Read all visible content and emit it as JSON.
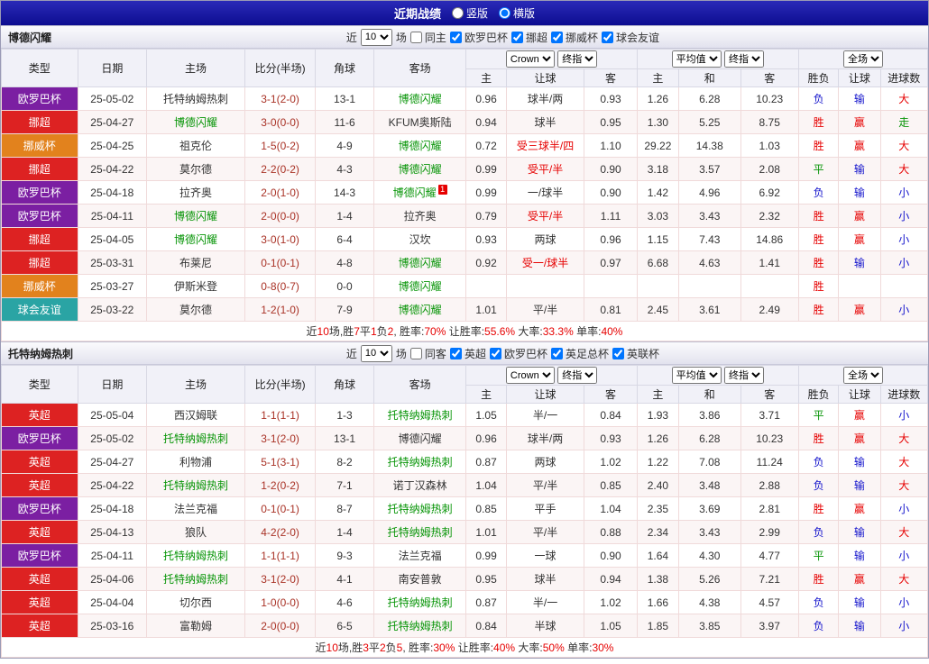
{
  "topbar": {
    "title": "近期战绩",
    "radios": {
      "vertical": "竖版",
      "horizontal": "横版",
      "selected": "横版"
    }
  },
  "table_head": {
    "type": "类型",
    "date": "日期",
    "home": "主场",
    "score": "比分(半场)",
    "corner": "角球",
    "away": "客场",
    "odds_home": "主",
    "odds_handicap": "让球",
    "odds_away": "客",
    "avg_home": "主",
    "avg_draw": "和",
    "avg_away": "客",
    "result": "胜负",
    "handicap_result": "让球",
    "goals": "进球数"
  },
  "palette": {
    "win_red": "#e60000",
    "lose_blue": "#1414cc",
    "draw_green": "#089508",
    "team_green": "#089508",
    "europa_purple": "#7b1fa2",
    "league_red": "#dd2222",
    "cup_orange": "#e2821d",
    "friendly_teal": "#2aa4a4"
  },
  "sections": [
    {
      "team": "博德闪耀",
      "filters": {
        "near": "近",
        "games": "10",
        "games_suffix": "场",
        "same": "同主",
        "same_checked": false,
        "leagues": [
          {
            "label": "欧罗巴杯",
            "checked": true
          },
          {
            "label": "挪超",
            "checked": true
          },
          {
            "label": "挪威杯",
            "checked": true
          },
          {
            "label": "球会友谊",
            "checked": true
          }
        ]
      },
      "selects": {
        "odds_source": "Crown",
        "odds_stage": "终指",
        "avg_source": "平均值",
        "avg_stage": "终指",
        "scope": "全场"
      },
      "rows": [
        {
          "lg": "欧罗巴杯",
          "lc": "#7b1fa2",
          "dt": "25-05-02",
          "hm": "托特纳姆热刺",
          "hmc": "#333333",
          "sc": "3-1(2-0)",
          "cn": "13-1",
          "aw": "博德闪耀",
          "awc": "#089508",
          "card": "",
          "o1": "0.96",
          "hd": "球半/两",
          "hdc": "#333333",
          "o2": "0.93",
          "m1": "1.26",
          "m2": "6.28",
          "m3": "10.23",
          "r1": "负",
          "r1c": "#1414cc",
          "r2": "输",
          "r2c": "#1414cc",
          "r3": "大",
          "r3c": "#e60000"
        },
        {
          "lg": "挪超",
          "lc": "#dd2222",
          "dt": "25-04-27",
          "hm": "博德闪耀",
          "hmc": "#089508",
          "sc": "3-0(0-0)",
          "cn": "11-6",
          "aw": "KFUM奥斯陆",
          "awc": "#333333",
          "card": "",
          "o1": "0.94",
          "hd": "球半",
          "hdc": "#333333",
          "o2": "0.95",
          "m1": "1.30",
          "m2": "5.25",
          "m3": "8.75",
          "r1": "胜",
          "r1c": "#e60000",
          "r2": "赢",
          "r2c": "#e60000",
          "r3": "走",
          "r3c": "#089508"
        },
        {
          "lg": "挪威杯",
          "lc": "#e2821d",
          "dt": "25-04-25",
          "hm": "祖克伦",
          "hmc": "#333333",
          "sc": "1-5(0-2)",
          "cn": "4-9",
          "aw": "博德闪耀",
          "awc": "#089508",
          "card": "",
          "o1": "0.72",
          "hd": "受三球半/四",
          "hdc": "#e60000",
          "o2": "1.10",
          "m1": "29.22",
          "m2": "14.38",
          "m3": "1.03",
          "r1": "胜",
          "r1c": "#e60000",
          "r2": "赢",
          "r2c": "#e60000",
          "r3": "大",
          "r3c": "#e60000"
        },
        {
          "lg": "挪超",
          "lc": "#dd2222",
          "dt": "25-04-22",
          "hm": "莫尔德",
          "hmc": "#333333",
          "sc": "2-2(0-2)",
          "cn": "4-3",
          "aw": "博德闪耀",
          "awc": "#089508",
          "card": "",
          "o1": "0.99",
          "hd": "受平/半",
          "hdc": "#e60000",
          "o2": "0.90",
          "m1": "3.18",
          "m2": "3.57",
          "m3": "2.08",
          "r1": "平",
          "r1c": "#089508",
          "r2": "输",
          "r2c": "#1414cc",
          "r3": "大",
          "r3c": "#e60000"
        },
        {
          "lg": "欧罗巴杯",
          "lc": "#7b1fa2",
          "dt": "25-04-18",
          "hm": "拉齐奥",
          "hmc": "#333333",
          "sc": "2-0(1-0)",
          "cn": "14-3",
          "aw": "博德闪耀",
          "awc": "#089508",
          "card": "1",
          "o1": "0.99",
          "hd": "一/球半",
          "hdc": "#333333",
          "o2": "0.90",
          "m1": "1.42",
          "m2": "4.96",
          "m3": "6.92",
          "r1": "负",
          "r1c": "#1414cc",
          "r2": "输",
          "r2c": "#1414cc",
          "r3": "小",
          "r3c": "#1414cc"
        },
        {
          "lg": "欧罗巴杯",
          "lc": "#7b1fa2",
          "dt": "25-04-11",
          "hm": "博德闪耀",
          "hmc": "#089508",
          "sc": "2-0(0-0)",
          "cn": "1-4",
          "aw": "拉齐奥",
          "awc": "#333333",
          "card": "",
          "o1": "0.79",
          "hd": "受平/半",
          "hdc": "#e60000",
          "o2": "1.11",
          "m1": "3.03",
          "m2": "3.43",
          "m3": "2.32",
          "r1": "胜",
          "r1c": "#e60000",
          "r2": "赢",
          "r2c": "#e60000",
          "r3": "小",
          "r3c": "#1414cc"
        },
        {
          "lg": "挪超",
          "lc": "#dd2222",
          "dt": "25-04-05",
          "hm": "博德闪耀",
          "hmc": "#089508",
          "sc": "3-0(1-0)",
          "cn": "6-4",
          "aw": "汉坎",
          "awc": "#333333",
          "card": "",
          "o1": "0.93",
          "hd": "两球",
          "hdc": "#333333",
          "o2": "0.96",
          "m1": "1.15",
          "m2": "7.43",
          "m3": "14.86",
          "r1": "胜",
          "r1c": "#e60000",
          "r2": "赢",
          "r2c": "#e60000",
          "r3": "小",
          "r3c": "#1414cc"
        },
        {
          "lg": "挪超",
          "lc": "#dd2222",
          "dt": "25-03-31",
          "hm": "布莱尼",
          "hmc": "#333333",
          "sc": "0-1(0-1)",
          "cn": "4-8",
          "aw": "博德闪耀",
          "awc": "#089508",
          "card": "",
          "o1": "0.92",
          "hd": "受一/球半",
          "hdc": "#e60000",
          "o2": "0.97",
          "m1": "6.68",
          "m2": "4.63",
          "m3": "1.41",
          "r1": "胜",
          "r1c": "#e60000",
          "r2": "输",
          "r2c": "#1414cc",
          "r3": "小",
          "r3c": "#1414cc"
        },
        {
          "lg": "挪威杯",
          "lc": "#e2821d",
          "dt": "25-03-27",
          "hm": "伊斯米登",
          "hmc": "#333333",
          "sc": "0-8(0-7)",
          "cn": "0-0",
          "aw": "博德闪耀",
          "awc": "#089508",
          "card": "",
          "o1": "",
          "hd": "",
          "hdc": "#333333",
          "o2": "",
          "m1": "",
          "m2": "",
          "m3": "",
          "r1": "胜",
          "r1c": "#e60000",
          "r2": "",
          "r2c": "#333333",
          "r3": "",
          "r3c": "#333333"
        },
        {
          "lg": "球会友谊",
          "lc": "#2aa4a4",
          "dt": "25-03-22",
          "hm": "莫尔德",
          "hmc": "#333333",
          "sc": "1-2(1-0)",
          "cn": "7-9",
          "aw": "博德闪耀",
          "awc": "#089508",
          "card": "",
          "o1": "1.01",
          "hd": "平/半",
          "hdc": "#333333",
          "o2": "0.81",
          "m1": "2.45",
          "m2": "3.61",
          "m3": "2.49",
          "r1": "胜",
          "r1c": "#e60000",
          "r2": "赢",
          "r2c": "#e60000",
          "r3": "小",
          "r3c": "#1414cc"
        }
      ],
      "summary": [
        {
          "t": "近",
          "c": "#333333"
        },
        {
          "t": "10",
          "c": "#e60000"
        },
        {
          "t": "场,胜",
          "c": "#333333"
        },
        {
          "t": "7",
          "c": "#e60000"
        },
        {
          "t": "平",
          "c": "#333333"
        },
        {
          "t": "1",
          "c": "#e60000"
        },
        {
          "t": "负",
          "c": "#333333"
        },
        {
          "t": "2",
          "c": "#e60000"
        },
        {
          "t": ", 胜率:",
          "c": "#333333"
        },
        {
          "t": "70%",
          "c": "#e60000"
        },
        {
          "t": " 让胜率:",
          "c": "#333333"
        },
        {
          "t": "55.6%",
          "c": "#e60000"
        },
        {
          "t": " 大率:",
          "c": "#333333"
        },
        {
          "t": "33.3%",
          "c": "#e60000"
        },
        {
          "t": " 单率:",
          "c": "#333333"
        },
        {
          "t": "40%",
          "c": "#e60000"
        }
      ]
    },
    {
      "team": "托特纳姆热刺",
      "filters": {
        "near": "近",
        "games": "10",
        "games_suffix": "场",
        "same": "同客",
        "same_checked": false,
        "leagues": [
          {
            "label": "英超",
            "checked": true
          },
          {
            "label": "欧罗巴杯",
            "checked": true
          },
          {
            "label": "英足总杯",
            "checked": true
          },
          {
            "label": "英联杯",
            "checked": true
          }
        ]
      },
      "selects": {
        "odds_source": "Crown",
        "odds_stage": "终指",
        "avg_source": "平均值",
        "avg_stage": "终指",
        "scope": "全场"
      },
      "rows": [
        {
          "lg": "英超",
          "lc": "#dd2222",
          "dt": "25-05-04",
          "hm": "西汉姆联",
          "hmc": "#333333",
          "sc": "1-1(1-1)",
          "cn": "1-3",
          "aw": "托特纳姆热刺",
          "awc": "#089508",
          "card": "",
          "o1": "1.05",
          "hd": "半/一",
          "hdc": "#333333",
          "o2": "0.84",
          "m1": "1.93",
          "m2": "3.86",
          "m3": "3.71",
          "r1": "平",
          "r1c": "#089508",
          "r2": "赢",
          "r2c": "#e60000",
          "r3": "小",
          "r3c": "#1414cc"
        },
        {
          "lg": "欧罗巴杯",
          "lc": "#7b1fa2",
          "dt": "25-05-02",
          "hm": "托特纳姆热刺",
          "hmc": "#089508",
          "sc": "3-1(2-0)",
          "cn": "13-1",
          "aw": "博德闪耀",
          "awc": "#333333",
          "card": "",
          "o1": "0.96",
          "hd": "球半/两",
          "hdc": "#333333",
          "o2": "0.93",
          "m1": "1.26",
          "m2": "6.28",
          "m3": "10.23",
          "r1": "胜",
          "r1c": "#e60000",
          "r2": "赢",
          "r2c": "#e60000",
          "r3": "大",
          "r3c": "#e60000"
        },
        {
          "lg": "英超",
          "lc": "#dd2222",
          "dt": "25-04-27",
          "hm": "利物浦",
          "hmc": "#333333",
          "sc": "5-1(3-1)",
          "cn": "8-2",
          "aw": "托特纳姆热刺",
          "awc": "#089508",
          "card": "",
          "o1": "0.87",
          "hd": "两球",
          "hdc": "#333333",
          "o2": "1.02",
          "m1": "1.22",
          "m2": "7.08",
          "m3": "11.24",
          "r1": "负",
          "r1c": "#1414cc",
          "r2": "输",
          "r2c": "#1414cc",
          "r3": "大",
          "r3c": "#e60000"
        },
        {
          "lg": "英超",
          "lc": "#dd2222",
          "dt": "25-04-22",
          "hm": "托特纳姆热刺",
          "hmc": "#089508",
          "sc": "1-2(0-2)",
          "cn": "7-1",
          "aw": "诺丁汉森林",
          "awc": "#333333",
          "card": "",
          "o1": "1.04",
          "hd": "平/半",
          "hdc": "#333333",
          "o2": "0.85",
          "m1": "2.40",
          "m2": "3.48",
          "m3": "2.88",
          "r1": "负",
          "r1c": "#1414cc",
          "r2": "输",
          "r2c": "#1414cc",
          "r3": "大",
          "r3c": "#e60000"
        },
        {
          "lg": "欧罗巴杯",
          "lc": "#7b1fa2",
          "dt": "25-04-18",
          "hm": "法兰克福",
          "hmc": "#333333",
          "sc": "0-1(0-1)",
          "cn": "8-7",
          "aw": "托特纳姆热刺",
          "awc": "#089508",
          "card": "",
          "o1": "0.85",
          "hd": "平手",
          "hdc": "#333333",
          "o2": "1.04",
          "m1": "2.35",
          "m2": "3.69",
          "m3": "2.81",
          "r1": "胜",
          "r1c": "#e60000",
          "r2": "赢",
          "r2c": "#e60000",
          "r3": "小",
          "r3c": "#1414cc"
        },
        {
          "lg": "英超",
          "lc": "#dd2222",
          "dt": "25-04-13",
          "hm": "狼队",
          "hmc": "#333333",
          "sc": "4-2(2-0)",
          "cn": "1-4",
          "aw": "托特纳姆热刺",
          "awc": "#089508",
          "card": "",
          "o1": "1.01",
          "hd": "平/半",
          "hdc": "#333333",
          "o2": "0.88",
          "m1": "2.34",
          "m2": "3.43",
          "m3": "2.99",
          "r1": "负",
          "r1c": "#1414cc",
          "r2": "输",
          "r2c": "#1414cc",
          "r3": "大",
          "r3c": "#e60000"
        },
        {
          "lg": "欧罗巴杯",
          "lc": "#7b1fa2",
          "dt": "25-04-11",
          "hm": "托特纳姆热刺",
          "hmc": "#089508",
          "sc": "1-1(1-1)",
          "cn": "9-3",
          "aw": "法兰克福",
          "awc": "#333333",
          "card": "",
          "o1": "0.99",
          "hd": "一球",
          "hdc": "#333333",
          "o2": "0.90",
          "m1": "1.64",
          "m2": "4.30",
          "m3": "4.77",
          "r1": "平",
          "r1c": "#089508",
          "r2": "输",
          "r2c": "#1414cc",
          "r3": "小",
          "r3c": "#1414cc"
        },
        {
          "lg": "英超",
          "lc": "#dd2222",
          "dt": "25-04-06",
          "hm": "托特纳姆热刺",
          "hmc": "#089508",
          "sc": "3-1(2-0)",
          "cn": "4-1",
          "aw": "南安普敦",
          "awc": "#333333",
          "card": "",
          "o1": "0.95",
          "hd": "球半",
          "hdc": "#333333",
          "o2": "0.94",
          "m1": "1.38",
          "m2": "5.26",
          "m3": "7.21",
          "r1": "胜",
          "r1c": "#e60000",
          "r2": "赢",
          "r2c": "#e60000",
          "r3": "大",
          "r3c": "#e60000"
        },
        {
          "lg": "英超",
          "lc": "#dd2222",
          "dt": "25-04-04",
          "hm": "切尔西",
          "hmc": "#333333",
          "sc": "1-0(0-0)",
          "cn": "4-6",
          "aw": "托特纳姆热刺",
          "awc": "#089508",
          "card": "",
          "o1": "0.87",
          "hd": "半/一",
          "hdc": "#333333",
          "o2": "1.02",
          "m1": "1.66",
          "m2": "4.38",
          "m3": "4.57",
          "r1": "负",
          "r1c": "#1414cc",
          "r2": "输",
          "r2c": "#1414cc",
          "r3": "小",
          "r3c": "#1414cc"
        },
        {
          "lg": "英超",
          "lc": "#dd2222",
          "dt": "25-03-16",
          "hm": "富勒姆",
          "hmc": "#333333",
          "sc": "2-0(0-0)",
          "cn": "6-5",
          "aw": "托特纳姆热刺",
          "awc": "#089508",
          "card": "",
          "o1": "0.84",
          "hd": "半球",
          "hdc": "#333333",
          "o2": "1.05",
          "m1": "1.85",
          "m2": "3.85",
          "m3": "3.97",
          "r1": "负",
          "r1c": "#1414cc",
          "r2": "输",
          "r2c": "#1414cc",
          "r3": "小",
          "r3c": "#1414cc"
        }
      ],
      "summary": [
        {
          "t": "近",
          "c": "#333333"
        },
        {
          "t": "10",
          "c": "#e60000"
        },
        {
          "t": "场,胜",
          "c": "#333333"
        },
        {
          "t": "3",
          "c": "#e60000"
        },
        {
          "t": "平",
          "c": "#333333"
        },
        {
          "t": "2",
          "c": "#e60000"
        },
        {
          "t": "负",
          "c": "#333333"
        },
        {
          "t": "5",
          "c": "#e60000"
        },
        {
          "t": ", 胜率:",
          "c": "#333333"
        },
        {
          "t": "30%",
          "c": "#e60000"
        },
        {
          "t": " 让胜率:",
          "c": "#333333"
        },
        {
          "t": "40%",
          "c": "#e60000"
        },
        {
          "t": " 大率:",
          "c": "#333333"
        },
        {
          "t": "50%",
          "c": "#e60000"
        },
        {
          "t": " 单率:",
          "c": "#333333"
        },
        {
          "t": "30%",
          "c": "#e60000"
        }
      ]
    }
  ]
}
